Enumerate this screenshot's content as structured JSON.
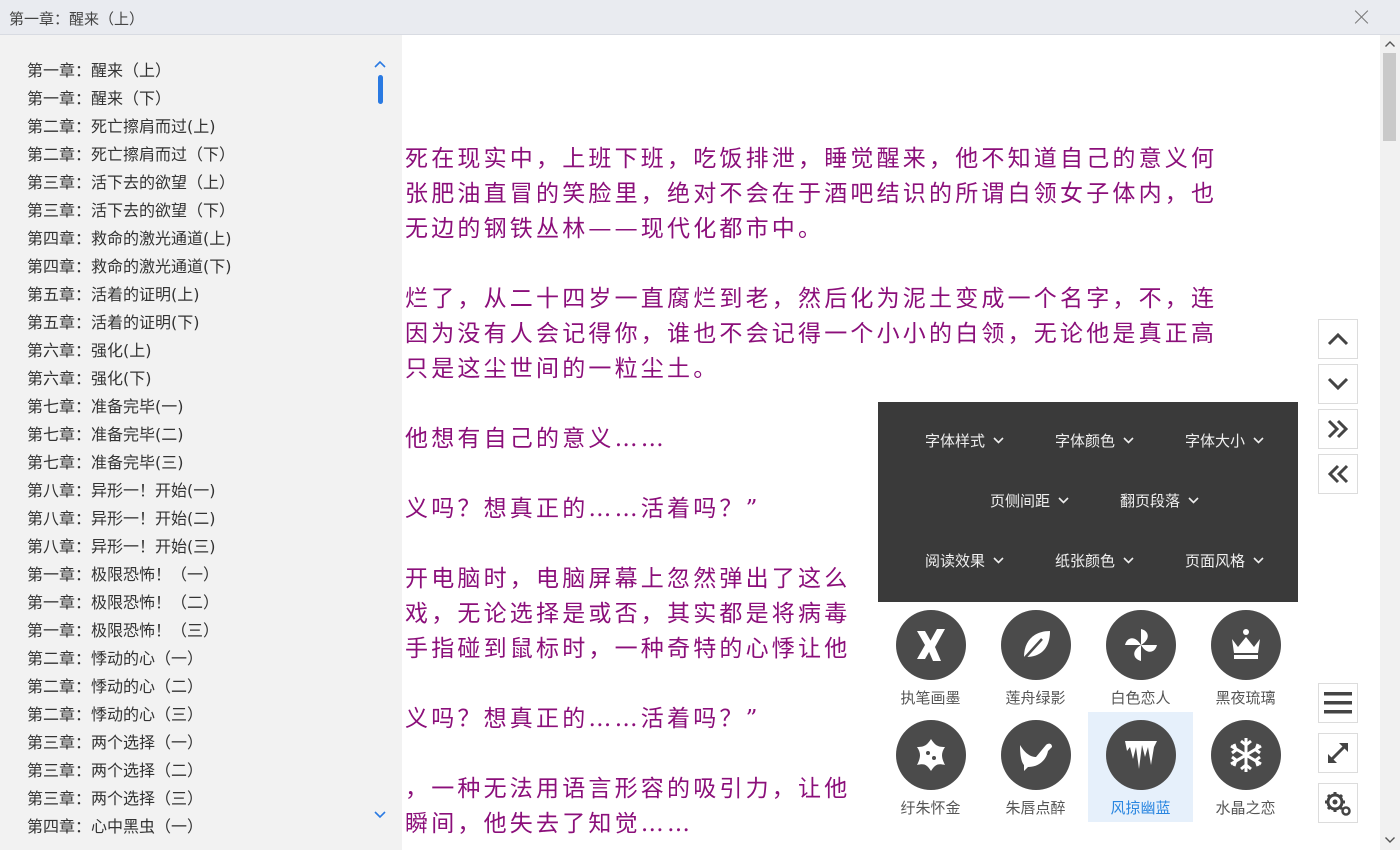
{
  "window": {
    "title": "第一章：醒来（上）"
  },
  "toc": {
    "items": [
      "第一章：醒来（上）",
      "第一章：醒来（下）",
      "第二章：死亡擦肩而过(上)",
      "第二章：死亡擦肩而过（下）",
      "第三章：活下去的欲望（上）",
      "第三章：活下去的欲望（下）",
      "第四章：救命的激光通道(上)",
      "第四章：救命的激光通道(下)",
      "第五章：活着的证明(上)",
      "第五章：活着的证明(下)",
      "第六章：强化(上)",
      "第六章：强化(下)",
      "第七章：准备完毕(一)",
      "第七章：准备完毕(二)",
      "第七章：准备完毕(三)",
      "第八章：异形一！开始(一)",
      "第八章：异形一！开始(二)",
      "第八章：异形一！开始(三)",
      "第一章：极限恐怖！（一）",
      "第一章：极限恐怖！（二）",
      "第一章：极限恐怖！（三）",
      "第二章：悸动的心（一）",
      "第二章：悸动的心（二）",
      "第二章：悸动的心（三）",
      "第三章：两个选择（一）",
      "第三章：两个选择（二）",
      "第三章：两个选择（三）",
      "第四章：心中黑虫（一）"
    ]
  },
  "reader": {
    "text_color": "#8b0f7a",
    "lines": [
      "死在现实中，上班下班，吃饭排泄，睡觉醒来，他不知道自己的意义何",
      "张肥油直冒的笑脸里，绝对不会在于酒吧结识的所谓白领女子体内，也",
      "无边的钢铁丛林——现代化都市中。",
      "烂了，从二十四岁一直腐烂到老，然后化为泥土变成一个名字，不，连",
      "因为没有人会记得你，谁也不会记得一个小小的白领，无论他是真正高",
      "只是这尘世间的一粒尘土。",
      "他想有自己的意义……",
      "义吗？想真正的……活着吗？”",
      "开电脑时，电脑屏幕上忽然弹出了这么",
      "戏，无论选择是或否，其实都是将病毒",
      "手指碰到鼠标时，一种奇特的心悸让他",
      "义吗？想真正的……活着吗？”",
      "，一种无法用语言形容的吸引力，让他",
      "瞬间，他失去了知觉……"
    ]
  },
  "settings": {
    "font_style": "字体样式",
    "font_color": "字体颜色",
    "font_size": "字体大小",
    "page_margin": "页侧间距",
    "page_turn": "翻页段落",
    "reading_effect": "阅读效果",
    "paper_color": "纸张颜色",
    "page_style": "页面风格"
  },
  "themes": {
    "items": [
      {
        "label": "执笔画墨",
        "icon": "xing-icon"
      },
      {
        "label": "莲舟绿影",
        "icon": "leaf-icon"
      },
      {
        "label": "白色恋人",
        "icon": "pinwheel-icon"
      },
      {
        "label": "黑夜琉璃",
        "icon": "crown-icon"
      },
      {
        "label": "纡朱怀金",
        "icon": "star-blob-icon"
      },
      {
        "label": "朱唇点醉",
        "icon": "dove-icon"
      },
      {
        "label": "风掠幽蓝",
        "icon": "icicle-icon"
      },
      {
        "label": "水晶之恋",
        "icon": "snowflake-icon"
      }
    ],
    "selected": "风掠幽蓝",
    "selected_color": "#2a86e0"
  },
  "side_buttons": [
    "scroll-up-icon",
    "scroll-down-icon",
    "next-chapter-icon",
    "prev-chapter-icon",
    "menu-icon",
    "fullscreen-icon",
    "settings-icon"
  ]
}
